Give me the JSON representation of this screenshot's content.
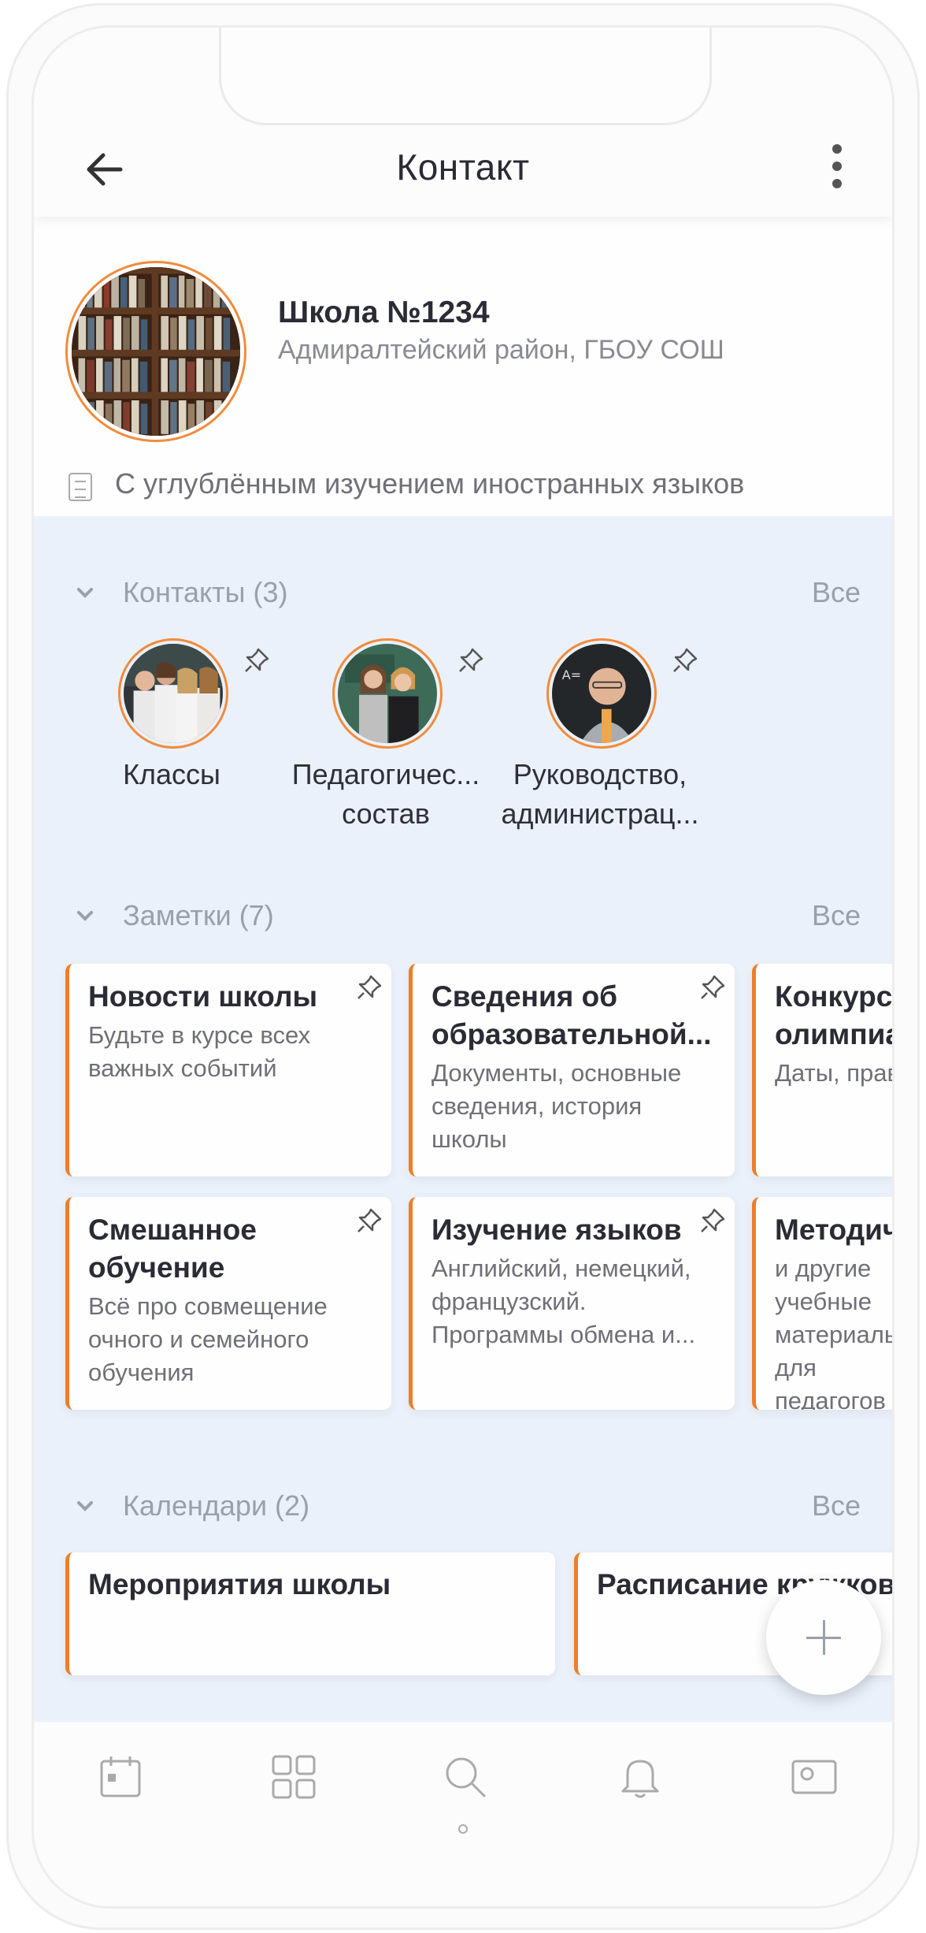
{
  "header": {
    "title": "Контакт"
  },
  "profile": {
    "name": "Школа №1234",
    "subtitle": "Адмиралтейский район, ГБОУ СОШ",
    "description": "С углублённым изучением иностранных языков"
  },
  "contacts_section": {
    "title": "Контакты (3)",
    "all_label": "Все",
    "items": [
      {
        "label": "Классы"
      },
      {
        "label": "Педагогичес... состав"
      },
      {
        "label": "Руководство, администрац..."
      }
    ]
  },
  "notes_section": {
    "title": "Заметки (7)",
    "all_label": "Все",
    "items": [
      {
        "title": "Новости школы",
        "subtitle": "Будьте в курсе всех важных событий"
      },
      {
        "title": "Сведения об образовательной...",
        "subtitle": "Документы, основные сведения, история школы"
      },
      {
        "title": "Конкурсы и олимпиады",
        "subtitle": "Даты, правила, заявки"
      },
      {
        "title": "Смешанное обучение",
        "subtitle": "Всё про совмещение очного и семейного обучения"
      },
      {
        "title": "Изучение языков",
        "subtitle": "Английский, немецкий, французский. Программы обмена и..."
      },
      {
        "title": "Методические",
        "subtitle": "и другие учебные материалы для педагогов"
      }
    ]
  },
  "calendars_section": {
    "title": "Календари (2)",
    "all_label": "Все",
    "items": [
      {
        "title": "Мероприятия школы"
      },
      {
        "title": "Расписание кружков"
      }
    ]
  },
  "colors": {
    "accent": "#ef7d28",
    "background": "#eaf1fa"
  },
  "bottom_nav": [
    "calendar-icon",
    "grid-icon",
    "search-icon",
    "bell-icon",
    "profile-card-icon"
  ]
}
